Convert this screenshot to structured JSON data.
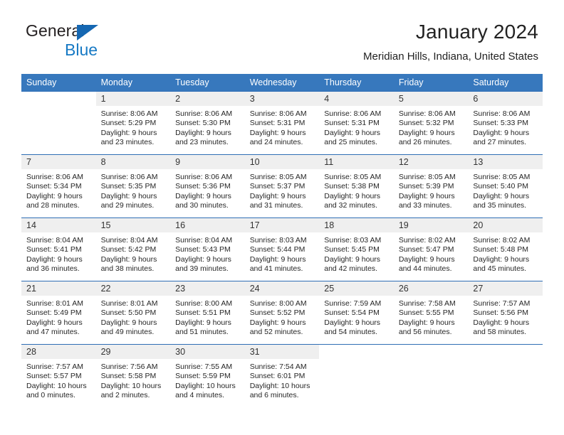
{
  "brand": {
    "name_part1": "General",
    "name_part2": "Blue",
    "triangle_color": "#1567b2",
    "blue_text_color": "#1679c4"
  },
  "header": {
    "title": "January 2024",
    "location": "Meridian Hills, Indiana, United States",
    "header_bg_color": "#3778bd",
    "row_divider_color": "#2f6eb5",
    "daynum_bg_color": "#efefef"
  },
  "weekdays": [
    "Sunday",
    "Monday",
    "Tuesday",
    "Wednesday",
    "Thursday",
    "Friday",
    "Saturday"
  ],
  "labels": {
    "sunrise_prefix": "Sunrise:",
    "sunset_prefix": "Sunset:",
    "daylight_prefix": "Daylight:"
  },
  "weeks": [
    [
      {
        "day": "",
        "sunrise": "",
        "sunset": "",
        "daylight_line1": "",
        "daylight_line2": ""
      },
      {
        "day": "1",
        "sunrise": "Sunrise: 8:06 AM",
        "sunset": "Sunset: 5:29 PM",
        "daylight_line1": "Daylight: 9 hours",
        "daylight_line2": "and 23 minutes."
      },
      {
        "day": "2",
        "sunrise": "Sunrise: 8:06 AM",
        "sunset": "Sunset: 5:30 PM",
        "daylight_line1": "Daylight: 9 hours",
        "daylight_line2": "and 23 minutes."
      },
      {
        "day": "3",
        "sunrise": "Sunrise: 8:06 AM",
        "sunset": "Sunset: 5:31 PM",
        "daylight_line1": "Daylight: 9 hours",
        "daylight_line2": "and 24 minutes."
      },
      {
        "day": "4",
        "sunrise": "Sunrise: 8:06 AM",
        "sunset": "Sunset: 5:31 PM",
        "daylight_line1": "Daylight: 9 hours",
        "daylight_line2": "and 25 minutes."
      },
      {
        "day": "5",
        "sunrise": "Sunrise: 8:06 AM",
        "sunset": "Sunset: 5:32 PM",
        "daylight_line1": "Daylight: 9 hours",
        "daylight_line2": "and 26 minutes."
      },
      {
        "day": "6",
        "sunrise": "Sunrise: 8:06 AM",
        "sunset": "Sunset: 5:33 PM",
        "daylight_line1": "Daylight: 9 hours",
        "daylight_line2": "and 27 minutes."
      }
    ],
    [
      {
        "day": "7",
        "sunrise": "Sunrise: 8:06 AM",
        "sunset": "Sunset: 5:34 PM",
        "daylight_line1": "Daylight: 9 hours",
        "daylight_line2": "and 28 minutes."
      },
      {
        "day": "8",
        "sunrise": "Sunrise: 8:06 AM",
        "sunset": "Sunset: 5:35 PM",
        "daylight_line1": "Daylight: 9 hours",
        "daylight_line2": "and 29 minutes."
      },
      {
        "day": "9",
        "sunrise": "Sunrise: 8:06 AM",
        "sunset": "Sunset: 5:36 PM",
        "daylight_line1": "Daylight: 9 hours",
        "daylight_line2": "and 30 minutes."
      },
      {
        "day": "10",
        "sunrise": "Sunrise: 8:05 AM",
        "sunset": "Sunset: 5:37 PM",
        "daylight_line1": "Daylight: 9 hours",
        "daylight_line2": "and 31 minutes."
      },
      {
        "day": "11",
        "sunrise": "Sunrise: 8:05 AM",
        "sunset": "Sunset: 5:38 PM",
        "daylight_line1": "Daylight: 9 hours",
        "daylight_line2": "and 32 minutes."
      },
      {
        "day": "12",
        "sunrise": "Sunrise: 8:05 AM",
        "sunset": "Sunset: 5:39 PM",
        "daylight_line1": "Daylight: 9 hours",
        "daylight_line2": "and 33 minutes."
      },
      {
        "day": "13",
        "sunrise": "Sunrise: 8:05 AM",
        "sunset": "Sunset: 5:40 PM",
        "daylight_line1": "Daylight: 9 hours",
        "daylight_line2": "and 35 minutes."
      }
    ],
    [
      {
        "day": "14",
        "sunrise": "Sunrise: 8:04 AM",
        "sunset": "Sunset: 5:41 PM",
        "daylight_line1": "Daylight: 9 hours",
        "daylight_line2": "and 36 minutes."
      },
      {
        "day": "15",
        "sunrise": "Sunrise: 8:04 AM",
        "sunset": "Sunset: 5:42 PM",
        "daylight_line1": "Daylight: 9 hours",
        "daylight_line2": "and 38 minutes."
      },
      {
        "day": "16",
        "sunrise": "Sunrise: 8:04 AM",
        "sunset": "Sunset: 5:43 PM",
        "daylight_line1": "Daylight: 9 hours",
        "daylight_line2": "and 39 minutes."
      },
      {
        "day": "17",
        "sunrise": "Sunrise: 8:03 AM",
        "sunset": "Sunset: 5:44 PM",
        "daylight_line1": "Daylight: 9 hours",
        "daylight_line2": "and 41 minutes."
      },
      {
        "day": "18",
        "sunrise": "Sunrise: 8:03 AM",
        "sunset": "Sunset: 5:45 PM",
        "daylight_line1": "Daylight: 9 hours",
        "daylight_line2": "and 42 minutes."
      },
      {
        "day": "19",
        "sunrise": "Sunrise: 8:02 AM",
        "sunset": "Sunset: 5:47 PM",
        "daylight_line1": "Daylight: 9 hours",
        "daylight_line2": "and 44 minutes."
      },
      {
        "day": "20",
        "sunrise": "Sunrise: 8:02 AM",
        "sunset": "Sunset: 5:48 PM",
        "daylight_line1": "Daylight: 9 hours",
        "daylight_line2": "and 45 minutes."
      }
    ],
    [
      {
        "day": "21",
        "sunrise": "Sunrise: 8:01 AM",
        "sunset": "Sunset: 5:49 PM",
        "daylight_line1": "Daylight: 9 hours",
        "daylight_line2": "and 47 minutes."
      },
      {
        "day": "22",
        "sunrise": "Sunrise: 8:01 AM",
        "sunset": "Sunset: 5:50 PM",
        "daylight_line1": "Daylight: 9 hours",
        "daylight_line2": "and 49 minutes."
      },
      {
        "day": "23",
        "sunrise": "Sunrise: 8:00 AM",
        "sunset": "Sunset: 5:51 PM",
        "daylight_line1": "Daylight: 9 hours",
        "daylight_line2": "and 51 minutes."
      },
      {
        "day": "24",
        "sunrise": "Sunrise: 8:00 AM",
        "sunset": "Sunset: 5:52 PM",
        "daylight_line1": "Daylight: 9 hours",
        "daylight_line2": "and 52 minutes."
      },
      {
        "day": "25",
        "sunrise": "Sunrise: 7:59 AM",
        "sunset": "Sunset: 5:54 PM",
        "daylight_line1": "Daylight: 9 hours",
        "daylight_line2": "and 54 minutes."
      },
      {
        "day": "26",
        "sunrise": "Sunrise: 7:58 AM",
        "sunset": "Sunset: 5:55 PM",
        "daylight_line1": "Daylight: 9 hours",
        "daylight_line2": "and 56 minutes."
      },
      {
        "day": "27",
        "sunrise": "Sunrise: 7:57 AM",
        "sunset": "Sunset: 5:56 PM",
        "daylight_line1": "Daylight: 9 hours",
        "daylight_line2": "and 58 minutes."
      }
    ],
    [
      {
        "day": "28",
        "sunrise": "Sunrise: 7:57 AM",
        "sunset": "Sunset: 5:57 PM",
        "daylight_line1": "Daylight: 10 hours",
        "daylight_line2": "and 0 minutes."
      },
      {
        "day": "29",
        "sunrise": "Sunrise: 7:56 AM",
        "sunset": "Sunset: 5:58 PM",
        "daylight_line1": "Daylight: 10 hours",
        "daylight_line2": "and 2 minutes."
      },
      {
        "day": "30",
        "sunrise": "Sunrise: 7:55 AM",
        "sunset": "Sunset: 5:59 PM",
        "daylight_line1": "Daylight: 10 hours",
        "daylight_line2": "and 4 minutes."
      },
      {
        "day": "31",
        "sunrise": "Sunrise: 7:54 AM",
        "sunset": "Sunset: 6:01 PM",
        "daylight_line1": "Daylight: 10 hours",
        "daylight_line2": "and 6 minutes."
      },
      {
        "day": "",
        "sunrise": "",
        "sunset": "",
        "daylight_line1": "",
        "daylight_line2": ""
      },
      {
        "day": "",
        "sunrise": "",
        "sunset": "",
        "daylight_line1": "",
        "daylight_line2": ""
      },
      {
        "day": "",
        "sunrise": "",
        "sunset": "",
        "daylight_line1": "",
        "daylight_line2": ""
      }
    ]
  ]
}
